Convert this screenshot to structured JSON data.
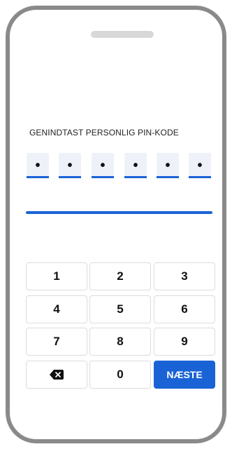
{
  "pin_entry": {
    "heading": "GENINDTAST PERSONLIG PIN-KODE",
    "digits": [
      "•",
      "•",
      "•",
      "•",
      "•",
      "•"
    ],
    "progress_fraction": 1.0
  },
  "keypad": {
    "keys": [
      "1",
      "2",
      "3",
      "4",
      "5",
      "6",
      "7",
      "8",
      "9"
    ],
    "zero": "0",
    "backspace_icon": "backspace-icon",
    "next_label": "NÆSTE"
  },
  "colors": {
    "accent": "#1a63d6",
    "frame": "#8a8a8a",
    "slot_background": "#eef2f8"
  }
}
